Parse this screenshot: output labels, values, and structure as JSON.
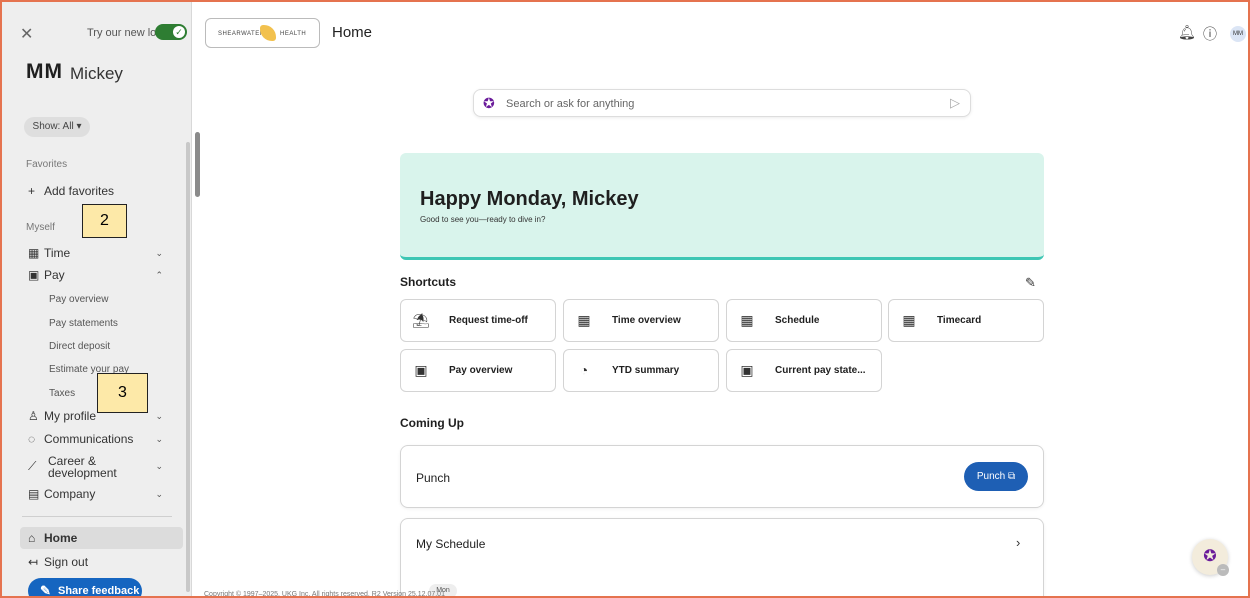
{
  "sidebar": {
    "close_icon": "close-icon",
    "try_new_look": "Try our new look",
    "toggle_on": true,
    "initials": "MM",
    "user_name": "Mickey",
    "show_filter": "Show: All ▾",
    "favorites_label": "Favorites",
    "add_favorites": "Add favorites",
    "myself_label": "Myself",
    "items": [
      {
        "label": "Time",
        "icon": "calendar-clock-icon",
        "expanded": false
      },
      {
        "label": "Pay",
        "icon": "money-icon",
        "expanded": true
      },
      {
        "label": "My profile",
        "icon": "person-icon",
        "expanded": false
      },
      {
        "label": "Communications",
        "icon": "chat-bubble-icon",
        "expanded": false
      },
      {
        "label": "Career & development",
        "icon": "growth-icon",
        "expanded": false
      },
      {
        "label": "Company",
        "icon": "building-icon",
        "expanded": false
      }
    ],
    "pay_subitems": [
      "Pay overview",
      "Pay statements",
      "Direct deposit",
      "Estimate your pay",
      "Taxes"
    ],
    "home_label": "Home",
    "sign_out_label": "Sign out",
    "feedback_label": "Share feedback"
  },
  "annotations": {
    "tag_2": "2",
    "tag_3": "3"
  },
  "header": {
    "logo_left": "SHEARWATER",
    "logo_right": "HEALTH",
    "page_title": "Home",
    "avatar_initials": "MM"
  },
  "search": {
    "placeholder": "Search or ask for anything"
  },
  "hero": {
    "title": "Happy Monday, Mickey",
    "subtitle": "Good to see you—ready to dive in?"
  },
  "shortcuts": {
    "title": "Shortcuts",
    "items": [
      {
        "label": "Request time-off",
        "icon": "beach-icon"
      },
      {
        "label": "Time overview",
        "icon": "calendar-clock-icon"
      },
      {
        "label": "Schedule",
        "icon": "calendar-clock-icon"
      },
      {
        "label": "Timecard",
        "icon": "calendar-clock-icon"
      },
      {
        "label": "Pay overview",
        "icon": "money-icon"
      },
      {
        "label": "YTD summary",
        "icon": "pie-chart-icon"
      },
      {
        "label": "Current pay state...",
        "icon": "money-icon"
      }
    ]
  },
  "coming_up": {
    "title": "Coming Up",
    "punch_title": "Punch",
    "punch_button": "Punch ⧉",
    "schedule_title": "My Schedule",
    "schedule_pill": "Mon"
  },
  "footer": {
    "text": "Copyright © 1997–2025, UKG Inc. All rights reserved. R2 Version 25.12.07.01"
  },
  "colors": {
    "accent": "#1e5fb4",
    "hero_bg": "#d9f4ec",
    "hero_border": "#3ec6b4",
    "frame": "#e5734f"
  }
}
